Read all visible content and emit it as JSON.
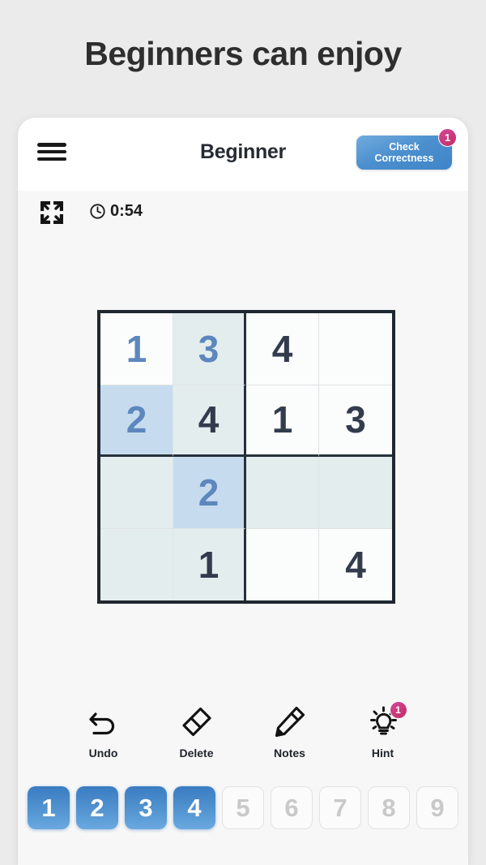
{
  "headline": "Beginners can enjoy",
  "app": {
    "menu_icon": "hamburger-menu-icon",
    "title": "Beginner",
    "check_button": {
      "line1": "Check",
      "line2": "Correctness",
      "badge": "1"
    },
    "status": {
      "fullscreen_icon": "fullscreen-expand-icon",
      "clock_icon": "clock-icon",
      "timer": "0:54"
    }
  },
  "board": {
    "size": 4,
    "cells": [
      {
        "value": "1",
        "kind": "user",
        "bg": "plain"
      },
      {
        "value": "3",
        "kind": "user",
        "bg": "tint"
      },
      {
        "value": "4",
        "kind": "given",
        "bg": "plain"
      },
      {
        "value": "",
        "kind": "empty",
        "bg": "plain"
      },
      {
        "value": "2",
        "kind": "user",
        "bg": "highlight"
      },
      {
        "value": "4",
        "kind": "given",
        "bg": "tint"
      },
      {
        "value": "1",
        "kind": "given",
        "bg": "plain"
      },
      {
        "value": "3",
        "kind": "given",
        "bg": "plain"
      },
      {
        "value": "",
        "kind": "empty",
        "bg": "tint"
      },
      {
        "value": "2",
        "kind": "user",
        "bg": "highlight"
      },
      {
        "value": "",
        "kind": "empty",
        "bg": "tint"
      },
      {
        "value": "",
        "kind": "empty",
        "bg": "tint"
      },
      {
        "value": "",
        "kind": "empty",
        "bg": "tint"
      },
      {
        "value": "1",
        "kind": "given",
        "bg": "tint"
      },
      {
        "value": "",
        "kind": "empty",
        "bg": "plain"
      },
      {
        "value": "4",
        "kind": "given",
        "bg": "plain"
      }
    ]
  },
  "tools": [
    {
      "label": "Undo",
      "icon": "undo-arrow-icon",
      "badge": ""
    },
    {
      "label": "Delete",
      "icon": "eraser-icon",
      "badge": ""
    },
    {
      "label": "Notes",
      "icon": "pencil-icon",
      "badge": ""
    },
    {
      "label": "Hint",
      "icon": "lightbulb-icon",
      "badge": "1"
    }
  ],
  "numpad": [
    {
      "label": "1",
      "state": "active"
    },
    {
      "label": "2",
      "state": "active"
    },
    {
      "label": "3",
      "state": "active"
    },
    {
      "label": "4",
      "state": "active"
    },
    {
      "label": "5",
      "state": "disabled"
    },
    {
      "label": "6",
      "state": "disabled"
    },
    {
      "label": "7",
      "state": "disabled"
    },
    {
      "label": "8",
      "state": "disabled"
    },
    {
      "label": "9",
      "state": "disabled"
    }
  ],
  "colors": {
    "page_bg": "#ebebeb",
    "card_bg": "#f7f7f7",
    "accent_blue": "#4b8fce",
    "badge_pink": "#c42b62",
    "given_number": "#333c4d",
    "user_number": "#5d87bd",
    "cell_tint": "#e4edee",
    "cell_highlight": "#c6dcee"
  }
}
